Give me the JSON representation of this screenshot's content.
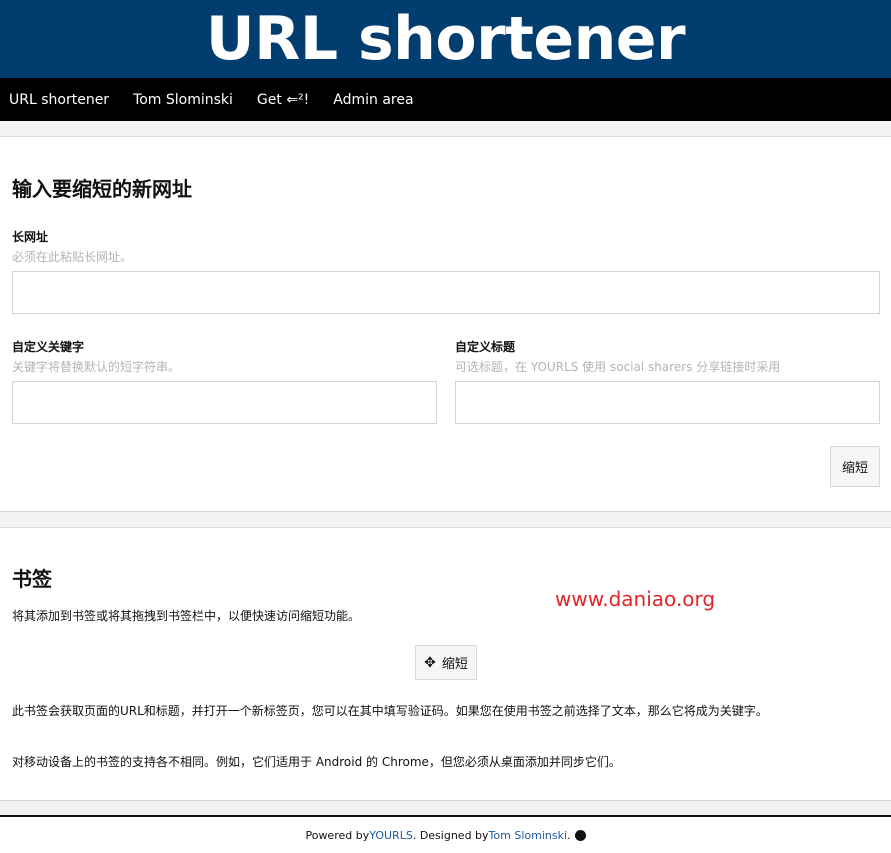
{
  "header": {
    "title": "URL shortener"
  },
  "nav": {
    "items": [
      {
        "label": "URL shortener"
      },
      {
        "label": "Tom Slominski"
      },
      {
        "label": "Get ⇐²!"
      },
      {
        "label": "Admin area"
      }
    ]
  },
  "form": {
    "heading": "输入要缩短的新网址",
    "long_url": {
      "label": "长网址",
      "hint": "必须在此粘贴长网址。",
      "value": ""
    },
    "keyword": {
      "label": "自定义关键字",
      "hint": "关键字将替换默认的短字符串。",
      "value": ""
    },
    "title_field": {
      "label": "自定义标题",
      "hint": "可选标题，在 YOURLS 使用 social sharers 分享链接时采用",
      "value": ""
    },
    "submit_label": "缩短"
  },
  "bookmarklet": {
    "heading": "书签",
    "intro": "将其添加到书签或将其拖拽到书签栏中，以便快速访问缩短功能。",
    "button_label": "缩短",
    "desc1": "此书签会获取页面的URL和标题，并打开一个新标签页，您可以在其中填写验证码。如果您在使用书签之前选择了文本，那么它将成为关键字。",
    "desc2": "对移动设备上的书签的支持各不相同。例如，它们适用于 Android 的 Chrome，但您必须从桌面添加并同步它们。"
  },
  "watermark": "www.daniao.org",
  "footer": {
    "powered": "Powered by ",
    "yourls": "YOURLS",
    "designed": ". Designed by ",
    "author": "Tom Slominski",
    "end": "."
  },
  "colors": {
    "header_bg": "#013d6e",
    "nav_bg": "#000000",
    "link": "#1e5aa6",
    "watermark": "#e0262a"
  }
}
